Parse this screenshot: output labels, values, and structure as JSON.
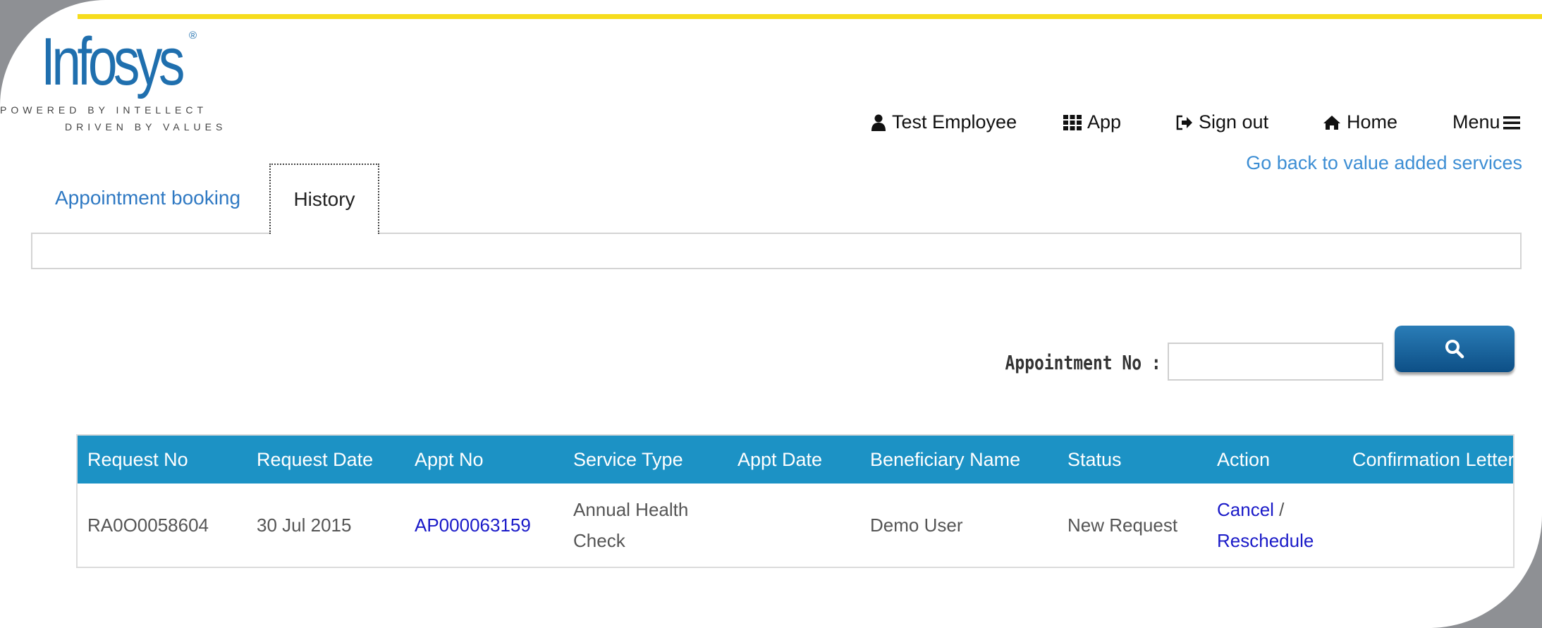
{
  "logo": {
    "brand": "Infosys",
    "registered_mark": "®",
    "tagline_line1": "POWERED BY INTELLECT",
    "tagline_line2": "DRIVEN BY VALUES"
  },
  "top_nav": {
    "user_label": "Test Employee",
    "app_label": "App",
    "signout_label": "Sign out",
    "home_label": "Home",
    "menu_label": "Menu"
  },
  "back_link": "Go back to value added services",
  "tabs": [
    {
      "label": "Appointment booking",
      "active": false
    },
    {
      "label": "History",
      "active": true
    }
  ],
  "search": {
    "label": "Appointment No :",
    "value": "",
    "button_icon": "search-icon"
  },
  "table": {
    "columns": [
      "Request No",
      "Request Date",
      "Appt No",
      "Service Type",
      "Appt Date",
      "Beneficiary Name",
      "Status",
      "Action",
      "Confirmation Letter"
    ],
    "rows": [
      {
        "request_no": "RA0O0058604",
        "request_date": "30 Jul 2015",
        "appt_no": "AP000063159",
        "service_type_line1": "Annual Health",
        "service_type_line2": "Check",
        "appt_date": "",
        "beneficiary_name": "Demo User",
        "status": "New Request",
        "action_cancel": "Cancel",
        "action_separator": "/",
        "action_reschedule": "Reschedule",
        "confirmation_letter": ""
      }
    ]
  },
  "colors": {
    "accent_line": "#f6dc1c",
    "brand_blue": "#1f6fae",
    "table_header": "#1c92c5",
    "link_blue": "#3d8ed4",
    "action_link": "#1a1ac8"
  }
}
